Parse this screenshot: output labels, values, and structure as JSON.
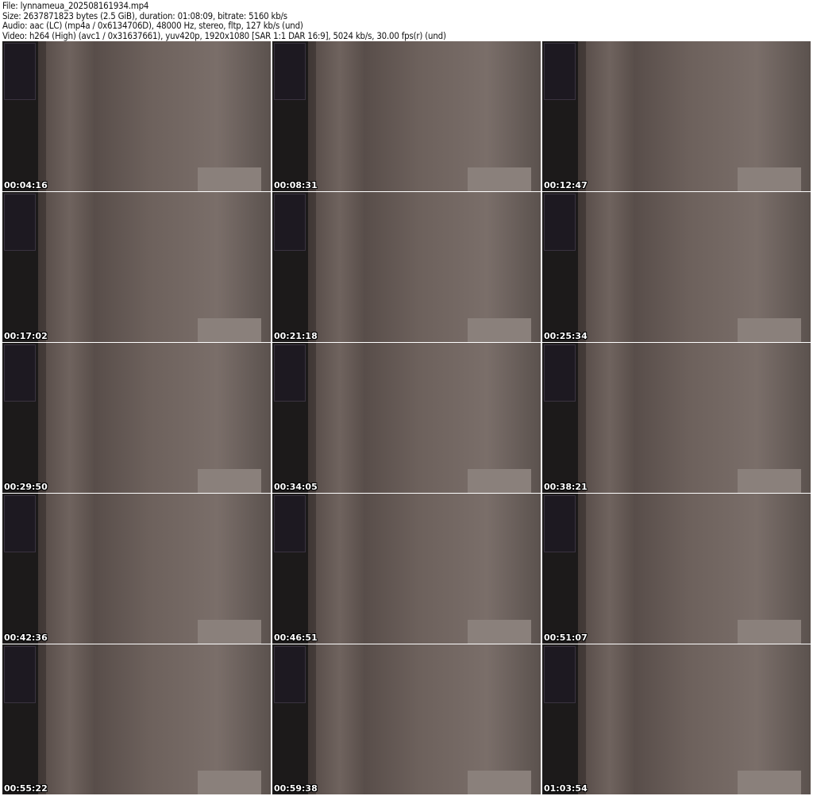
{
  "header": {
    "file": "File: lynnameua_202508161934.mp4",
    "size": "Size: 2637871823 bytes (2.5 GiB), duration: 01:08:09, bitrate: 5160 kb/s",
    "audio": "Audio: aac (LC) (mp4a / 0x6134706D), 48000 Hz, stereo, fltp, 127 kb/s (und)",
    "video": "Video: h264 (High) (avc1 / 0x31637661), yuv420p, 1920x1080 [SAR 1:1 DAR 16:9], 5024 kb/s, 30.00 fps(r) (und)"
  },
  "thumbnails": [
    {
      "timestamp": "00:04:16"
    },
    {
      "timestamp": "00:08:31"
    },
    {
      "timestamp": "00:12:47"
    },
    {
      "timestamp": "00:17:02"
    },
    {
      "timestamp": "00:21:18"
    },
    {
      "timestamp": "00:25:34"
    },
    {
      "timestamp": "00:29:50"
    },
    {
      "timestamp": "00:34:05"
    },
    {
      "timestamp": "00:38:21"
    },
    {
      "timestamp": "00:42:36"
    },
    {
      "timestamp": "00:46:51"
    },
    {
      "timestamp": "00:51:07"
    },
    {
      "timestamp": "00:55:22"
    },
    {
      "timestamp": "00:59:38"
    },
    {
      "timestamp": "01:03:54"
    }
  ]
}
